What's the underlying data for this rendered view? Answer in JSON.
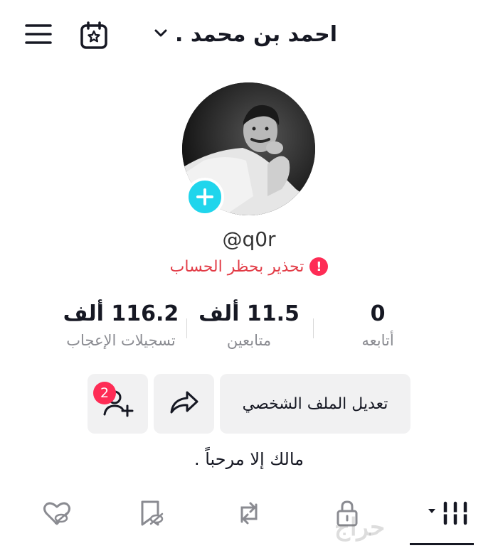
{
  "header": {
    "account_name": "احمد بن محمد .",
    "menu_icon": "hamburger-menu-icon",
    "calendar_icon": "calendar-star-icon",
    "dropdown_icon": "chevron-down-icon"
  },
  "profile": {
    "username": "@q0r",
    "warning_text": "تحذير بحظر الحساب",
    "warning_icon": "!",
    "avatar_add_icon": "plus-icon",
    "bio": "مالك إلا مرحباً ."
  },
  "stats": {
    "following": {
      "value": "0",
      "label": "أتابعه"
    },
    "followers": {
      "value": "11.5 ألف",
      "label": "متابعين"
    },
    "likes": {
      "value": "116.2 ألف",
      "label": "تسجيلات الإعجاب"
    }
  },
  "actions": {
    "edit_profile_label": "تعديل الملف الشخصي",
    "share_icon": "share-arrow-icon",
    "add_friend_icon": "add-friend-icon",
    "friend_request_count": "2"
  },
  "tabs": [
    {
      "icon": "videos-grid-icon",
      "active": true
    },
    {
      "icon": "lock-icon",
      "active": false
    },
    {
      "icon": "repost-icon",
      "active": false
    },
    {
      "icon": "favorites-hidden-icon",
      "active": false
    },
    {
      "icon": "liked-hidden-icon",
      "active": false
    }
  ],
  "watermark": "حراج",
  "colors": {
    "accent_red": "#fe2c55",
    "warning_text": "#e23b46",
    "avatar_add": "#20d5ec",
    "button_bg": "#f1f1f2",
    "secondary_text": "#8a8b91"
  }
}
